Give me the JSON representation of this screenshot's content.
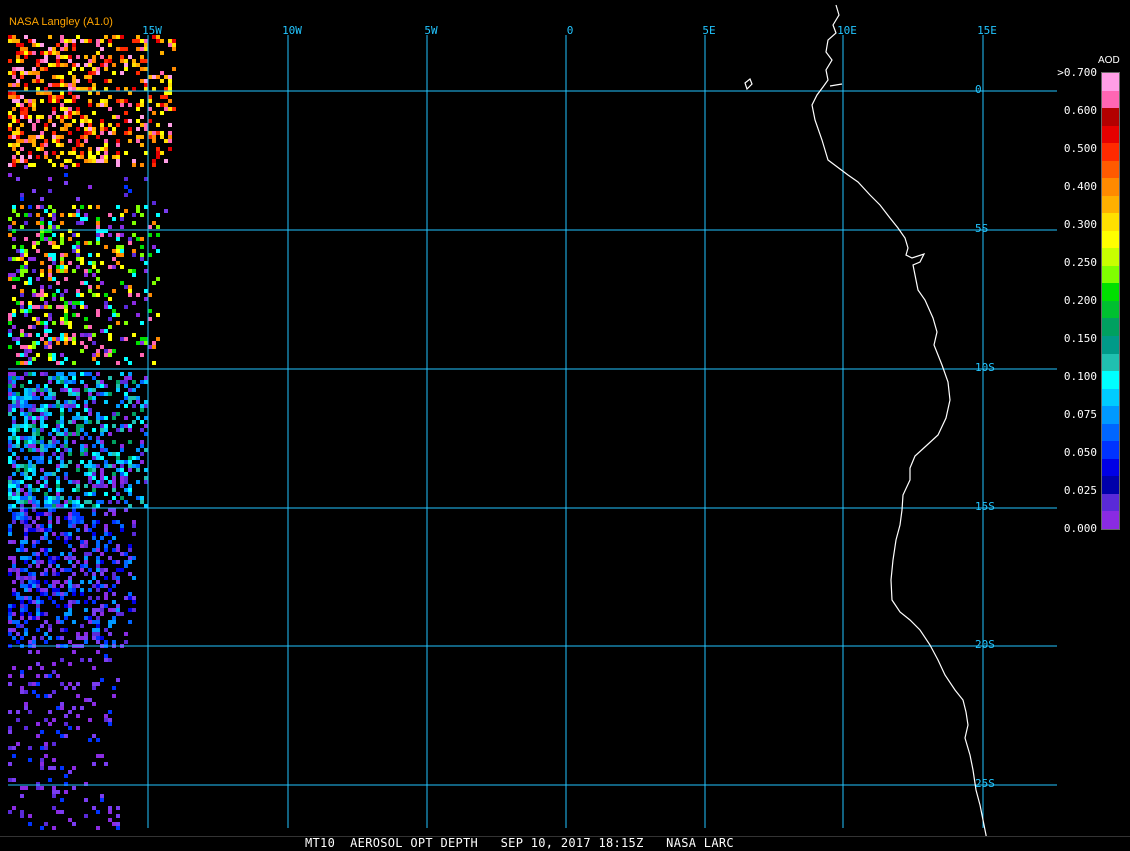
{
  "credit": "NASA Langley (A1.0)",
  "footer": "MT10  AEROSOL OPT DEPTH   SEP 10, 2017 18:15Z   NASA LARC",
  "lon_labels": [
    "15W",
    "10W",
    "5W",
    "0",
    "5E",
    "10E",
    "15E"
  ],
  "lat_labels": [
    "0",
    "5S",
    "10S",
    "15S",
    "20S",
    "25S"
  ],
  "legend": {
    "title": "AOD",
    "ticks": [
      ">0.700",
      "0.600",
      "0.500",
      "0.400",
      "0.300",
      "0.250",
      "0.200",
      "0.150",
      "0.100",
      "0.075",
      "0.050",
      "0.025",
      "0.000"
    ],
    "colors": [
      "#ff9ee6",
      "#ff66b3",
      "#b30000",
      "#e60000",
      "#ff2a00",
      "#ff5a00",
      "#ff8a00",
      "#ffb000",
      "#ffe000",
      "#ffff00",
      "#c8ff00",
      "#80ff00",
      "#00e000",
      "#00c030",
      "#00a060",
      "#009a88",
      "#20c0b0",
      "#00ffff",
      "#00ccff",
      "#0099ff",
      "#0066ff",
      "#0033ff",
      "#0000e6",
      "#0000aa",
      "#5a2ad8",
      "#8a2be2"
    ]
  },
  "colors": {
    "grid": "#22c5ff",
    "coast": "#ffffff",
    "credit": "#ffa500"
  }
}
